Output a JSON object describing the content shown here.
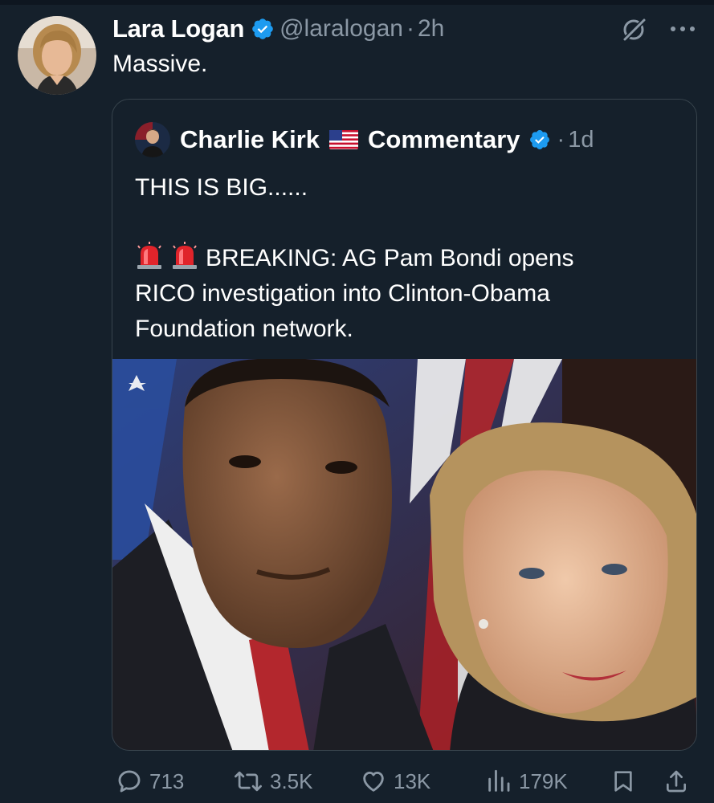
{
  "tweet": {
    "author_name": "Lara Logan",
    "handle": "@laralogan",
    "separator": "·",
    "time": "2h",
    "text": "Massive."
  },
  "quote": {
    "author_name": "Charlie Kirk",
    "author_name_part2": "Commentary",
    "separator": "·",
    "time": "1d",
    "lines": [
      "THIS IS BIG......",
      "",
      "BREAKING: AG Pam Bondi opens",
      "RICO investigation into Clinton-Obama",
      "Foundation network."
    ]
  },
  "actions": {
    "replies": "713",
    "reposts": "3.5K",
    "likes": "13K",
    "views": "179K"
  },
  "icons": {
    "verified": "verified-badge-icon",
    "grok": "grok-icon",
    "more": "more-icon",
    "flag": "us-flag-icon",
    "siren": "police-light-icon",
    "reply": "reply-icon",
    "repost": "repost-icon",
    "like": "heart-icon",
    "views": "views-icon",
    "bookmark": "bookmark-icon",
    "share": "share-icon"
  },
  "colors": {
    "background": "#15202b",
    "text": "#ffffff",
    "muted": "#8b98a5",
    "verified": "#1d9bf0",
    "border": "#38444d"
  }
}
